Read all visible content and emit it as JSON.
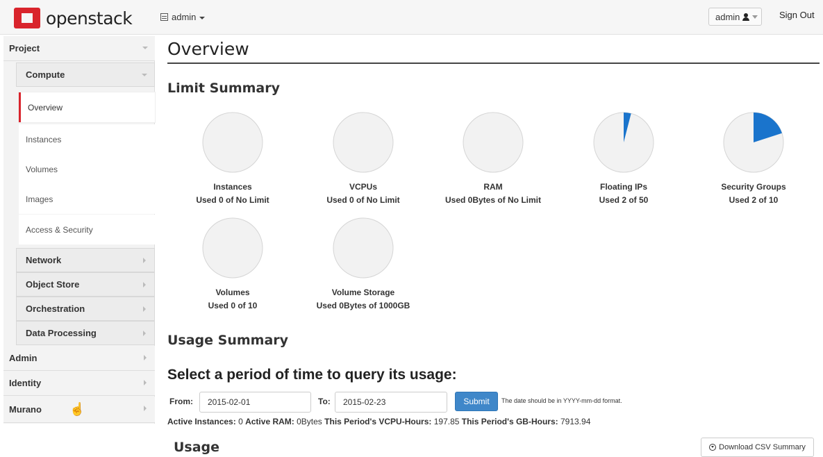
{
  "header": {
    "logo_text": "openstack",
    "project_label": "admin",
    "user_label": "admin",
    "signout_label": "Sign Out"
  },
  "sidebar": {
    "project": "Project",
    "compute": "Compute",
    "items": [
      "Overview",
      "Instances",
      "Volumes",
      "Images",
      "Access & Security"
    ],
    "subgroups": [
      "Network",
      "Object Store",
      "Orchestration",
      "Data Processing"
    ],
    "dashboards": [
      "Admin",
      "Identity",
      "Murano"
    ]
  },
  "main": {
    "title": "Overview",
    "limit_summary": "Limit Summary",
    "usage_summary": "Usage Summary",
    "period_heading": "Select a period of time to query its usage:",
    "from_label": "From:",
    "from_value": "2015-02-01",
    "to_label": "To:",
    "to_value": "2015-02-23",
    "submit_label": "Submit",
    "date_hint": "The date should be in YYYY-mm-dd format.",
    "stats": {
      "active_instances_label": "Active Instances:",
      "active_instances": "0",
      "active_ram_label": "Active RAM:",
      "active_ram": "0Bytes",
      "vcpu_hours_label": "This Period's VCPU-Hours:",
      "vcpu_hours": "197.85",
      "gb_hours_label": "This Period's GB-Hours:",
      "gb_hours": "7913.94"
    },
    "usage_heading": "Usage",
    "csv_label": "Download CSV Summary"
  },
  "limits": [
    {
      "name": "Instances",
      "used": "Used 0 of No Limit",
      "fraction": 0
    },
    {
      "name": "VCPUs",
      "used": "Used 0 of No Limit",
      "fraction": 0
    },
    {
      "name": "RAM",
      "used": "Used 0Bytes of No Limit",
      "fraction": 0
    },
    {
      "name": "Floating IPs",
      "used": "Used 2 of 50",
      "fraction": 0.04
    },
    {
      "name": "Security Groups",
      "used": "Used 2 of 10",
      "fraction": 0.2
    },
    {
      "name": "Volumes",
      "used": "Used 0 of 10",
      "fraction": 0
    },
    {
      "name": "Volume Storage",
      "used": "Used 0Bytes of 1000GB",
      "fraction": 0
    }
  ],
  "colors": {
    "pie_fill": "#1a74cc",
    "pie_bg": "#f2f2f2",
    "pie_border": "#d5d5d5",
    "accent": "#d9242c"
  }
}
